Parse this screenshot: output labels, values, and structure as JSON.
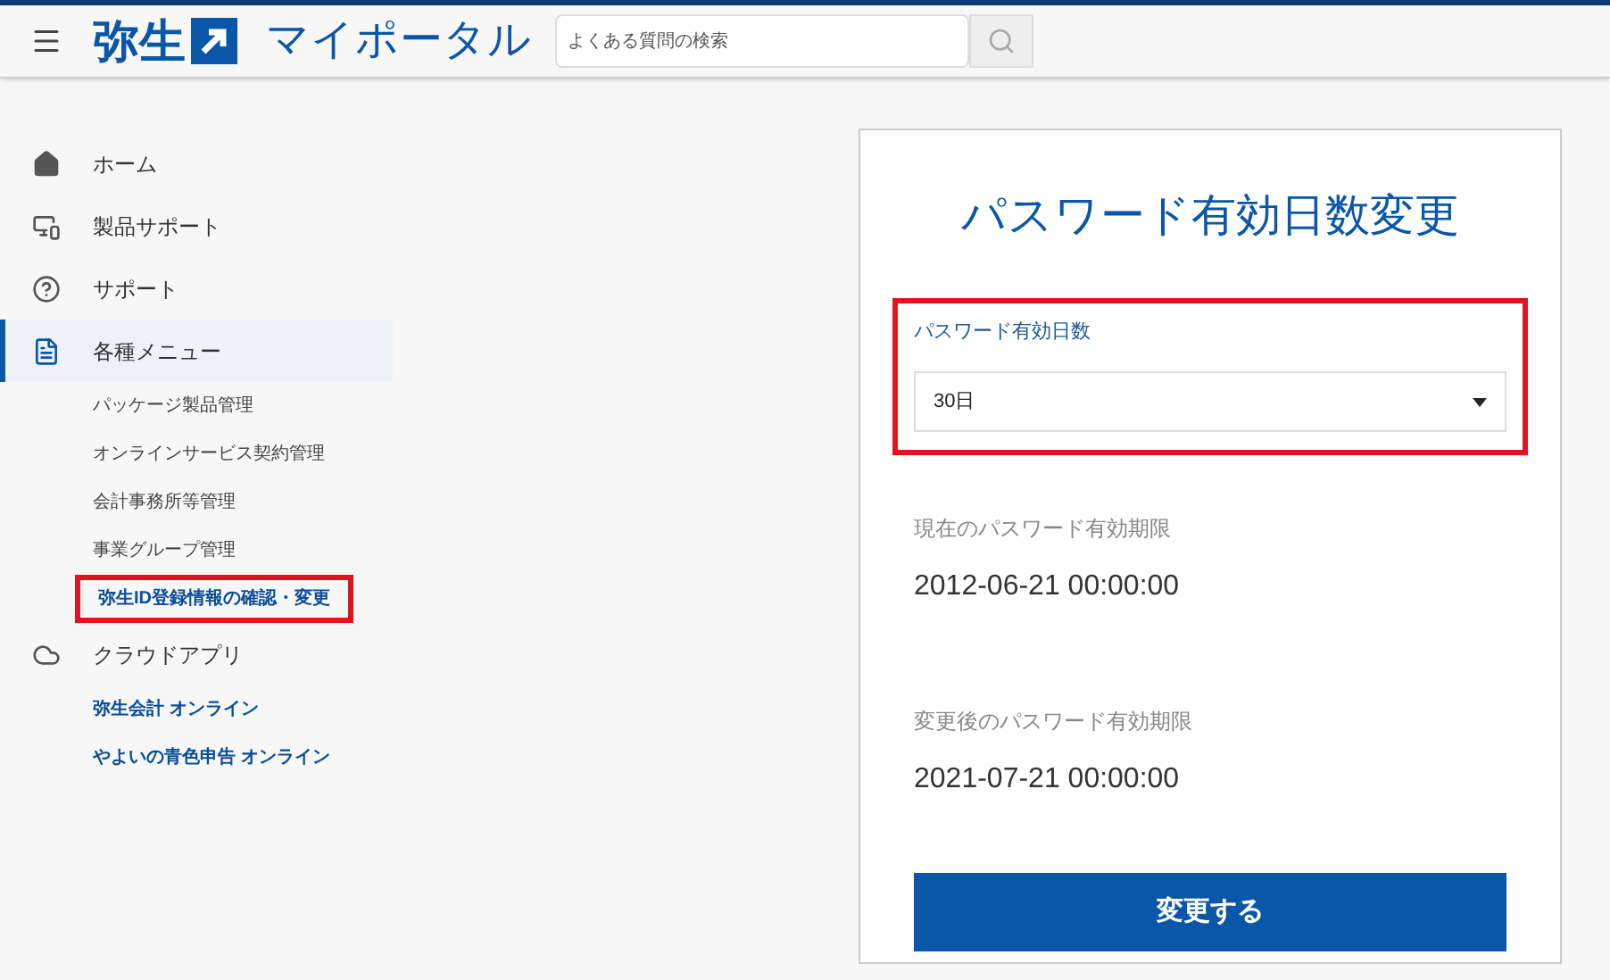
{
  "header": {
    "logo_text": "弥生",
    "title": "マイポータル",
    "search": {
      "placeholder": "よくある質問の検索"
    }
  },
  "sidebar": {
    "items": [
      {
        "label": "ホーム",
        "selected": false
      },
      {
        "label": "製品サポート",
        "selected": false
      },
      {
        "label": "サポート",
        "selected": false
      },
      {
        "label": "各種メニュー",
        "selected": true,
        "children": [
          {
            "label": "パッケージ製品管理",
            "highlighted": false
          },
          {
            "label": "オンラインサービス契約管理",
            "highlighted": false
          },
          {
            "label": "会計事務所等管理",
            "highlighted": false
          },
          {
            "label": "事業グループ管理",
            "highlighted": false
          },
          {
            "label": "弥生ID登録情報の確認・変更",
            "highlighted": true
          }
        ]
      },
      {
        "label": "クラウドアプリ",
        "selected": false,
        "children": [
          {
            "label": "弥生会計 オンライン",
            "highlighted": false
          },
          {
            "label": "やよいの青色申告 オンライン",
            "highlighted": false
          }
        ]
      }
    ]
  },
  "card": {
    "title": "パスワード有効日数変更",
    "select": {
      "label": "パスワード有効日数",
      "value": "30日",
      "highlighted": true
    },
    "fields": [
      {
        "label": "現在のパスワード有効期限",
        "value": "2012-06-21 00:00:00"
      },
      {
        "label": "変更後のパスワード有効期限",
        "value": "2021-07-21 00:00:00"
      }
    ],
    "button": "変更する"
  }
}
